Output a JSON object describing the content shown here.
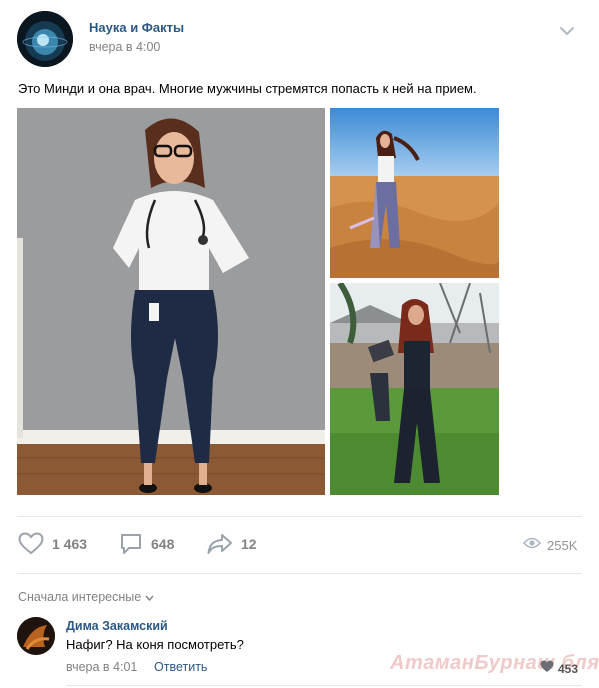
{
  "post": {
    "group_name": "Наука и Факты",
    "time": "вчера в 4:00",
    "text": "Это Минди и она врач. Многие мужчины стремятся попасть к ней на прием.",
    "photos": [
      "doctor-photo",
      "desert-photo",
      "yard-photo"
    ]
  },
  "actions": {
    "likes": "1 463",
    "comments": "648",
    "shares": "12",
    "views": "255K"
  },
  "comments_section": {
    "sort_label": "Сначала интересные",
    "items": [
      {
        "author": "Дима Закамский",
        "text": "Нафиг? На коня посмотреть?",
        "time": "вчера в 4:01",
        "reply_label": "Ответить",
        "likes": "453"
      }
    ]
  },
  "watermark": "АтаманБурнаш бля",
  "colors": {
    "link": "#2a5885",
    "muted": "#828282",
    "divider": "#e7e8ec"
  }
}
